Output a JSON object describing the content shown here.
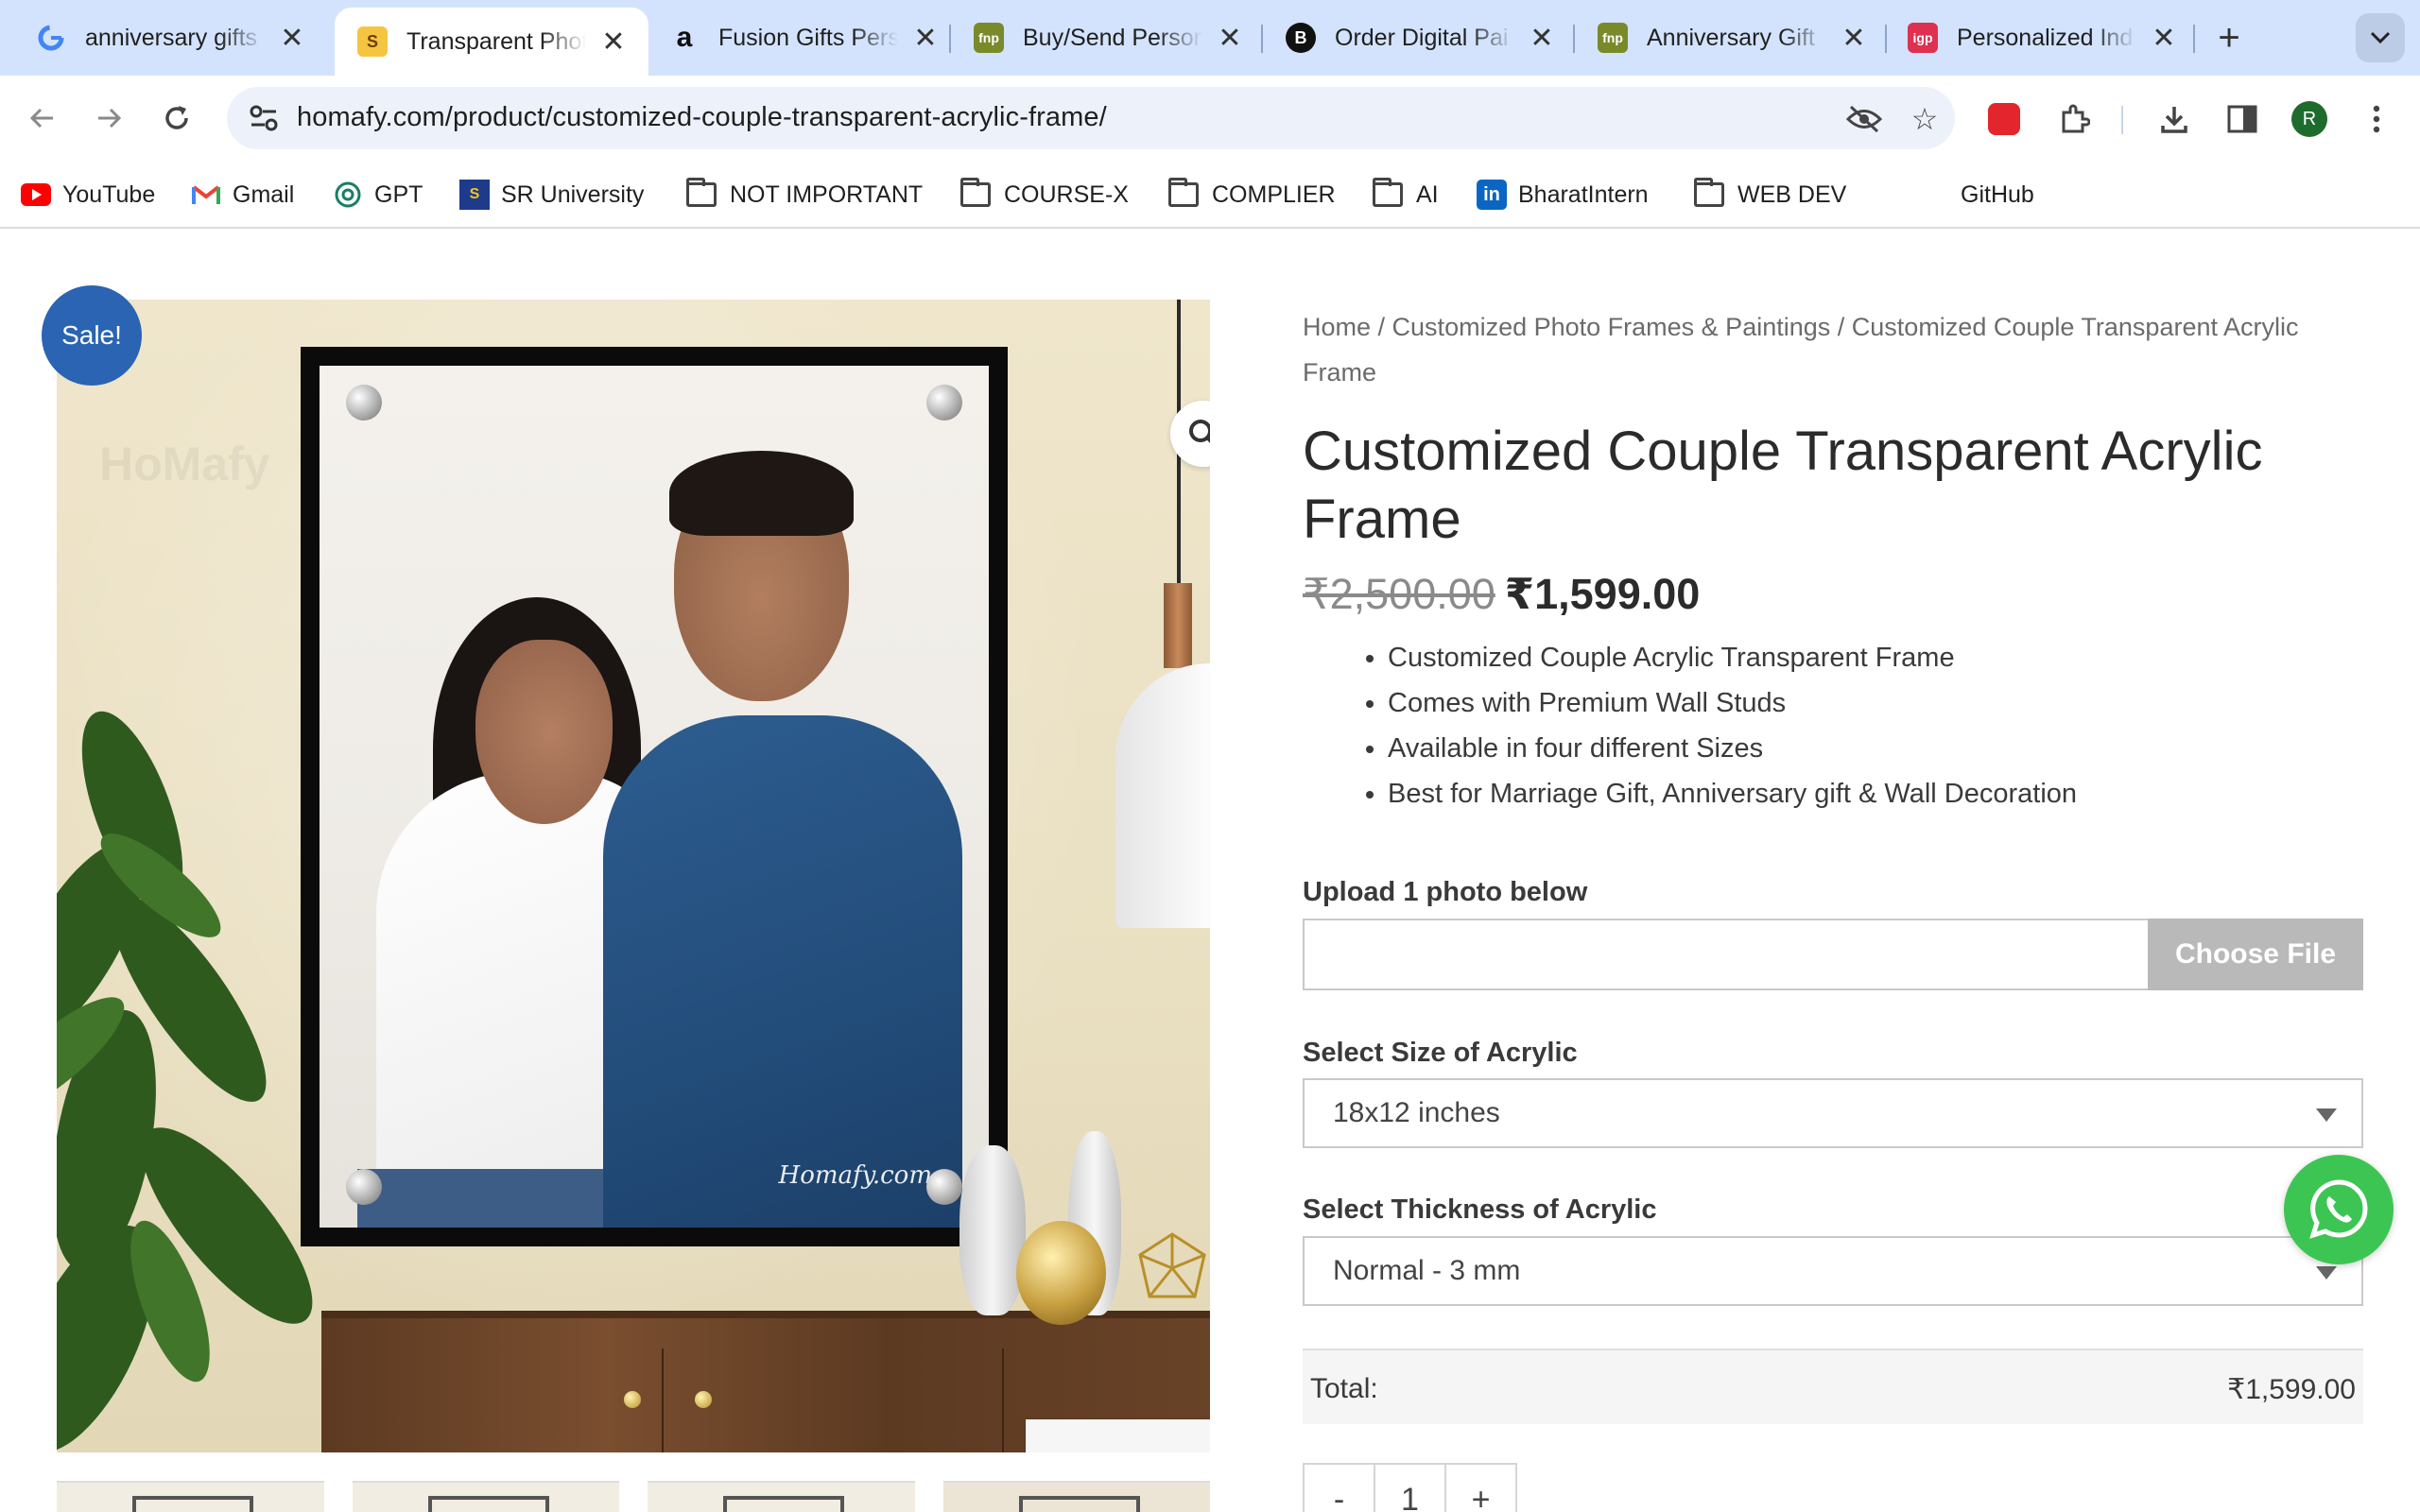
{
  "browser": {
    "tabs": [
      {
        "title": "anniversary gifts",
        "icon": "google-icon"
      },
      {
        "title": "Transparent Photo",
        "icon": "homafy-icon",
        "active": true
      },
      {
        "title": "Fusion Gifts Pers",
        "icon": "amazon-icon"
      },
      {
        "title": "Buy/Send Person",
        "icon": "fnp-icon"
      },
      {
        "title": "Order Digital Pai",
        "icon": "bonsai-icon"
      },
      {
        "title": "Anniversary Gift",
        "icon": "fnp-icon"
      },
      {
        "title": "Personalized Ind",
        "icon": "igp-icon"
      }
    ],
    "url": "homafy.com/product/customized-couple-transparent-acrylic-frame/",
    "profile_initial": "R",
    "bookmarks": [
      {
        "label": "YouTube",
        "icon": "youtube-icon"
      },
      {
        "label": "Gmail",
        "icon": "gmail-icon"
      },
      {
        "label": "GPT",
        "icon": "openai-icon"
      },
      {
        "label": "SR University",
        "icon": "sru-icon"
      },
      {
        "label": "NOT IMPORTANT",
        "icon": "folder-icon"
      },
      {
        "label": "COURSE-X",
        "icon": "folder-icon"
      },
      {
        "label": "COMPLIER",
        "icon": "folder-icon"
      },
      {
        "label": "AI",
        "icon": "folder-icon"
      },
      {
        "label": "BharatIntern",
        "icon": "linkedin-icon"
      },
      {
        "label": "WEB DEV",
        "icon": "folder-icon"
      },
      {
        "label": "GitHub",
        "icon": "github-icon"
      }
    ]
  },
  "product": {
    "sale_badge": "Sale!",
    "image_signature": "Homafy.com",
    "image_watermark": "HoMafy",
    "breadcrumb": {
      "home": "Home",
      "sep": " / ",
      "category": "Customized Photo Frames & Paintings",
      "current": "Customized Couple Transparent Acrylic Frame"
    },
    "title": "Customized Couple Transparent Acrylic Frame",
    "price_old": "₹2,500.00",
    "price_new": "₹1,599.00",
    "features": [
      "Customized Couple Acrylic Transparent Frame",
      "Comes with Premium Wall Studs",
      "Available in four different Sizes",
      "Best for Marriage Gift, Anniversary gift & Wall Decoration"
    ],
    "upload_label": "Upload 1 photo below",
    "choose_file": "Choose File",
    "size_label": "Select Size of Acrylic",
    "size_value": "18x12 inches",
    "thickness_label": "Select Thickness of Acrylic",
    "thickness_value": "Normal - 3 mm",
    "total_label": "Total:",
    "total_value": "₹1,599.00",
    "qty_minus": "-",
    "qty_value": "1",
    "qty_plus": "+"
  },
  "colors": {
    "tabstrip": "#d3e3fd",
    "sale_badge": "#2a64b2",
    "whatsapp": "#3dc553"
  }
}
